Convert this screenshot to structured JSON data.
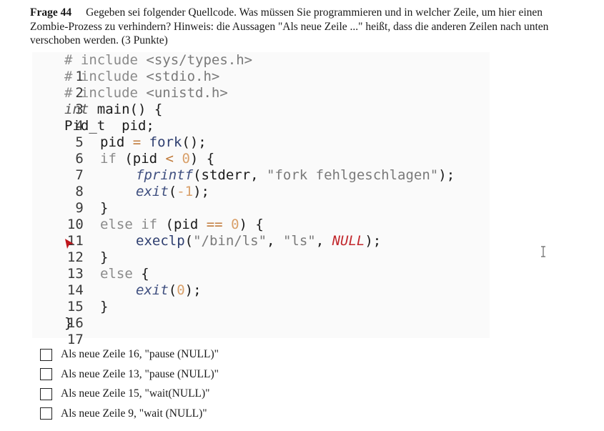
{
  "question": {
    "number": "Frage 44",
    "text": "Gegeben sei folgender Quellcode. Was müssen Sie programmieren und in welcher Zeile, um hier einen Zombie-Prozess zu verhindern? Hinweis: die Aussagen \"Als neue Zeile ...\" heißt, dass die anderen Zeilen nach unten verschoben werden. (3 Punkte)"
  },
  "code": {
    "line_numbers": [
      "1",
      "2",
      "3",
      "4",
      "5",
      "6",
      "7",
      "8",
      "9",
      "10",
      "11",
      "12",
      "13",
      "14",
      "15",
      "16",
      "17"
    ],
    "l1": [
      "# include ",
      "<sys/types.h>"
    ],
    "l2": [
      "# include ",
      "<stdio.h>"
    ],
    "l3": [
      "# include ",
      "<unistd.h>"
    ],
    "l4": [
      "int",
      " main() {"
    ],
    "l5": [
      "Pid_t  pid;"
    ],
    "l6": [
      "pid ",
      "=",
      " fork",
      "();"
    ],
    "l7": [
      "if",
      " (pid ",
      "<",
      " ",
      "0",
      ") {"
    ],
    "l8": [
      "fprintf",
      "(stderr, ",
      "\"fork fehlgeschlagen\"",
      ");"
    ],
    "l9": [
      "exit",
      "(",
      "-1",
      ");"
    ],
    "l10": [
      "}"
    ],
    "l11": [
      "else if",
      " (pid ",
      "==",
      " ",
      "0",
      ") {"
    ],
    "l12": [
      "execlp",
      "(",
      "\"/bin/ls\"",
      ", ",
      "\"ls\"",
      ", ",
      "NULL",
      ");"
    ],
    "l13": [
      "}"
    ],
    "l14": [
      "else",
      " {"
    ],
    "l15": [
      "exit",
      "(",
      "0",
      ");"
    ],
    "l16": [
      "}"
    ],
    "l17": [
      "}"
    ]
  },
  "options": [
    "Als neue Zeile 16, \"pause (NULL)\"",
    "Als neue Zeile 13, \"pause (NULL)\"",
    "Als neue Zeile 15, \"wait(NULL)\"",
    "Als neue Zeile 9, \"wait (NULL)\""
  ]
}
